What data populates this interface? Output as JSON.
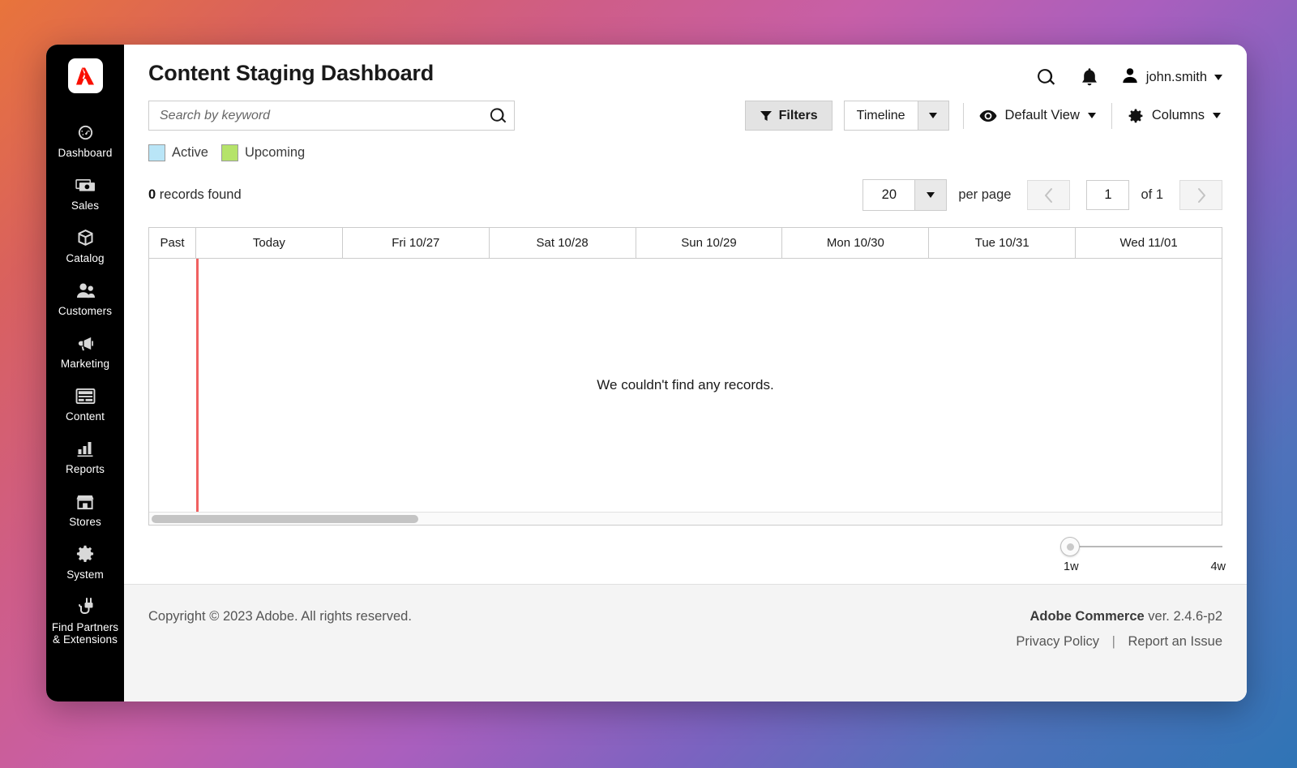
{
  "sidebar": {
    "logo_icon": "adobe-logo-icon",
    "items": [
      {
        "label": "Dashboard",
        "icon": "speedometer-icon"
      },
      {
        "label": "Sales",
        "icon": "money-stack-icon"
      },
      {
        "label": "Catalog",
        "icon": "box-icon"
      },
      {
        "label": "Customers",
        "icon": "people-icon"
      },
      {
        "label": "Marketing",
        "icon": "megaphone-icon"
      },
      {
        "label": "Content",
        "icon": "page-layout-icon"
      },
      {
        "label": "Reports",
        "icon": "bar-chart-icon"
      },
      {
        "label": "Stores",
        "icon": "storefront-icon"
      },
      {
        "label": "System",
        "icon": "gear-icon"
      },
      {
        "label": "Find Partners\n& Extensions",
        "icon": "plug-icon"
      }
    ]
  },
  "header": {
    "title": "Content Staging Dashboard",
    "search_icon": "search-icon",
    "notifications_icon": "bell-icon",
    "avatar_icon": "user-avatar-icon",
    "user_name": "john.smith",
    "caret_icon": "chevron-down-icon"
  },
  "search": {
    "placeholder": "Search by keyword",
    "value": "",
    "submit_icon": "search-icon"
  },
  "toolbar": {
    "filters_label": "Filters",
    "filters_icon": "funnel-icon",
    "timeline_label": "Timeline",
    "timeline_arrow_icon": "chevron-down-icon",
    "view_label": "Default View",
    "view_icon": "eye-icon",
    "view_caret_icon": "chevron-down-icon",
    "columns_label": "Columns",
    "columns_icon": "gear-icon",
    "columns_caret_icon": "chevron-down-icon"
  },
  "legend": [
    {
      "label": "Active",
      "color": "#b9e5f7"
    },
    {
      "label": "Upcoming",
      "color": "#b5e36a"
    }
  ],
  "results": {
    "count": "0",
    "records_text": " records found"
  },
  "pagination": {
    "per_page_value": "20",
    "per_page_arrow_icon": "chevron-down-icon",
    "per_page_label": "per page",
    "prev_icon": "chevron-left-icon",
    "next_icon": "chevron-right-icon",
    "current_page": "1",
    "of_label": "of 1"
  },
  "timeline": {
    "columns": [
      "Past",
      "Today",
      "Fri 10/27",
      "Sat 10/28",
      "Sun 10/29",
      "Mon 10/30",
      "Tue 10/31",
      "Wed 11/01"
    ],
    "empty_message": "We couldn't find any records.",
    "today_marker_color": "#f06060"
  },
  "zoom_slider": {
    "min_label": "1w",
    "max_label": "4w",
    "value": "1w"
  },
  "footer": {
    "copyright": "Copyright © 2023 Adobe. All rights reserved.",
    "product": "Adobe Commerce",
    "version": " ver. 2.4.6-p2",
    "privacy_link": "Privacy Policy",
    "separator": "|",
    "report_link": "Report an Issue"
  }
}
